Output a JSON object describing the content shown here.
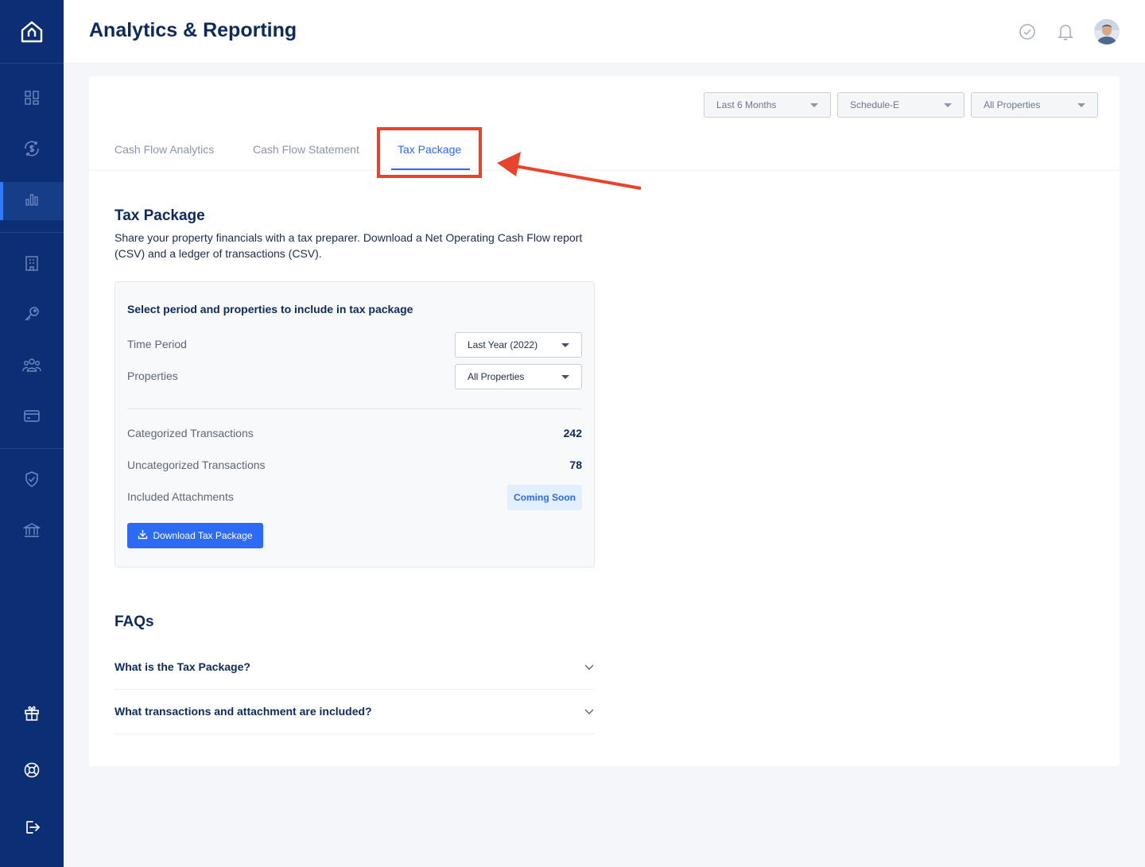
{
  "header": {
    "title": "Analytics & Reporting"
  },
  "sidebar": {
    "items": [
      {
        "icon": "dashboard-icon"
      },
      {
        "icon": "cash-flow-icon"
      },
      {
        "icon": "analytics-icon",
        "active": true
      },
      {
        "icon": "building-icon"
      },
      {
        "icon": "key-icon"
      },
      {
        "icon": "people-icon"
      },
      {
        "icon": "credit-card-icon"
      },
      {
        "icon": "shield-icon"
      },
      {
        "icon": "bank-icon"
      },
      {
        "icon": "gift-icon"
      },
      {
        "icon": "help-icon"
      },
      {
        "icon": "logout-icon"
      }
    ]
  },
  "filters": {
    "period": "Last 6 Months",
    "schedule": "Schedule-E",
    "properties": "All Properties"
  },
  "tabs": [
    {
      "label": "Cash Flow Analytics"
    },
    {
      "label": "Cash Flow Statement"
    },
    {
      "label": "Tax Package",
      "active": true
    }
  ],
  "section": {
    "title": "Tax Package",
    "description": "Share your property financials with a tax preparer. Download a Net Operating Cash Flow report (CSV) and a ledger of transactions (CSV)."
  },
  "package": {
    "title": "Select period and properties to include in tax package",
    "time_period_label": "Time Period",
    "time_period_value": "Last Year (2022)",
    "properties_label": "Properties",
    "properties_value": "All Properties",
    "categorized_label": "Categorized Transactions",
    "categorized_value": "242",
    "uncategorized_label": "Uncategorized Transactions",
    "uncategorized_value": "78",
    "attachments_label": "Included Attachments",
    "attachments_badge": "Coming Soon",
    "download_label": "Download Tax Package"
  },
  "faq": {
    "title": "FAQs",
    "items": [
      {
        "question": "What is the Tax Package?"
      },
      {
        "question": "What transactions and attachment are included?"
      }
    ]
  },
  "colors": {
    "sidebar": "#0b2e74",
    "accent": "#2d6bf5",
    "annotation": "#e8442c"
  }
}
